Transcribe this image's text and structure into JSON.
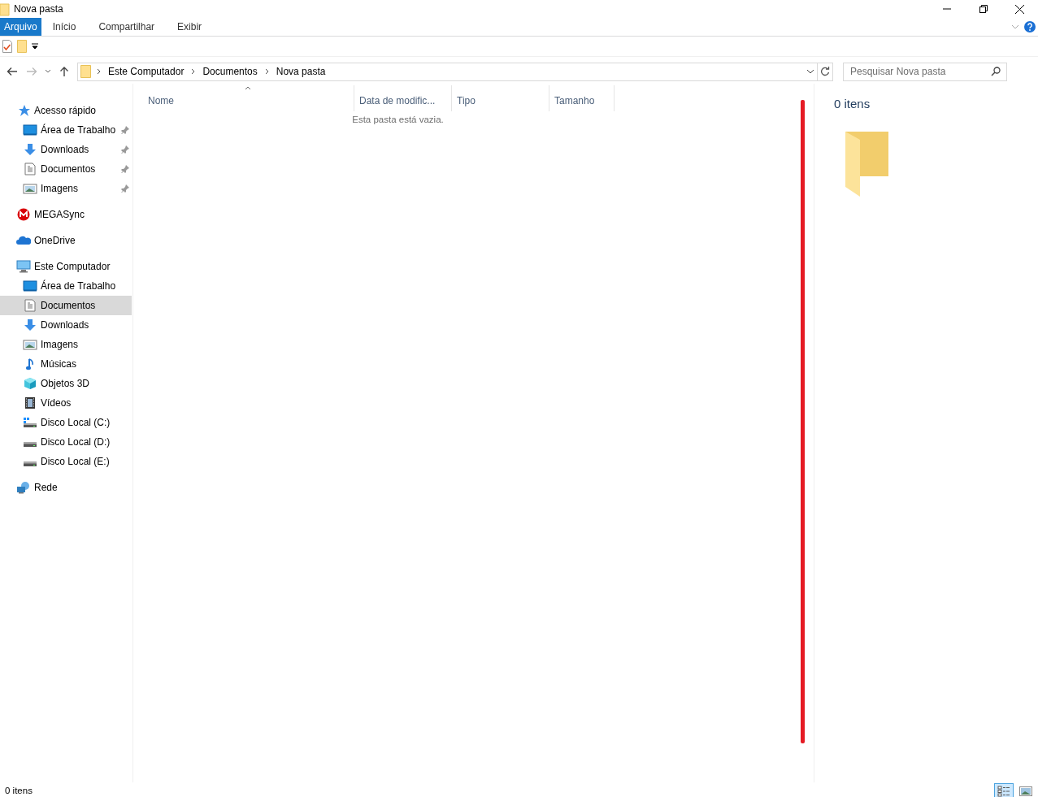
{
  "window": {
    "title": "Nova pasta"
  },
  "ribbon_tabs": [
    {
      "label": "Arquivo",
      "selected": true
    },
    {
      "label": "Início",
      "selected": false
    },
    {
      "label": "Compartilhar",
      "selected": false
    },
    {
      "label": "Exibir",
      "selected": false
    }
  ],
  "address_bar": {
    "path": [
      "Este Computador",
      "Documentos",
      "Nova pasta"
    ]
  },
  "search": {
    "placeholder": "Pesquisar Nova pasta"
  },
  "sidebar": {
    "items": [
      {
        "label": "Acesso rápido",
        "kind": "star",
        "selected": false,
        "children": [
          {
            "label": "Área de Trabalho",
            "kind": "desktop",
            "pinned": true,
            "selected": false
          },
          {
            "label": "Downloads",
            "kind": "download",
            "pinned": true,
            "selected": false
          },
          {
            "label": "Documentos",
            "kind": "document",
            "pinned": true,
            "selected": false
          },
          {
            "label": "Imagens",
            "kind": "picture",
            "pinned": true,
            "selected": false
          }
        ]
      },
      {
        "label": "MEGASync",
        "kind": "mega",
        "selected": false
      },
      {
        "label": "OneDrive",
        "kind": "cloud",
        "selected": false
      },
      {
        "label": "Este Computador",
        "kind": "computer",
        "selected": false,
        "children": [
          {
            "label": "Área de Trabalho",
            "kind": "desktop",
            "pinned": false,
            "selected": false
          },
          {
            "label": "Documentos",
            "kind": "document",
            "pinned": false,
            "selected": true
          },
          {
            "label": "Downloads",
            "kind": "download",
            "pinned": false,
            "selected": false
          },
          {
            "label": "Imagens",
            "kind": "picture",
            "pinned": false,
            "selected": false
          },
          {
            "label": "Músicas",
            "kind": "music",
            "pinned": false,
            "selected": false
          },
          {
            "label": "Objetos 3D",
            "kind": "cube",
            "pinned": false,
            "selected": false
          },
          {
            "label": "Vídeos",
            "kind": "film",
            "pinned": false,
            "selected": false
          },
          {
            "label": "Disco Local (C:)",
            "kind": "system-drive",
            "pinned": false,
            "selected": false
          },
          {
            "label": "Disco Local (D:)",
            "kind": "drive",
            "pinned": false,
            "selected": false
          },
          {
            "label": "Disco Local (E:)",
            "kind": "drive",
            "pinned": false,
            "selected": false
          }
        ]
      },
      {
        "label": "Rede",
        "kind": "network",
        "selected": false
      }
    ]
  },
  "table": {
    "columns": [
      {
        "label": "Nome",
        "sorted": true
      },
      {
        "label": "Data de modific...",
        "sorted": false
      },
      {
        "label": "Tipo",
        "sorted": false
      },
      {
        "label": "Tamanho",
        "sorted": false
      }
    ],
    "empty_message": "Esta pasta está vazia."
  },
  "preview": {
    "count": "0 itens"
  },
  "status_bar": {
    "count": "0 itens",
    "views": [
      {
        "kind": "details",
        "selected": true
      },
      {
        "kind": "large-icons",
        "selected": false
      }
    ]
  }
}
